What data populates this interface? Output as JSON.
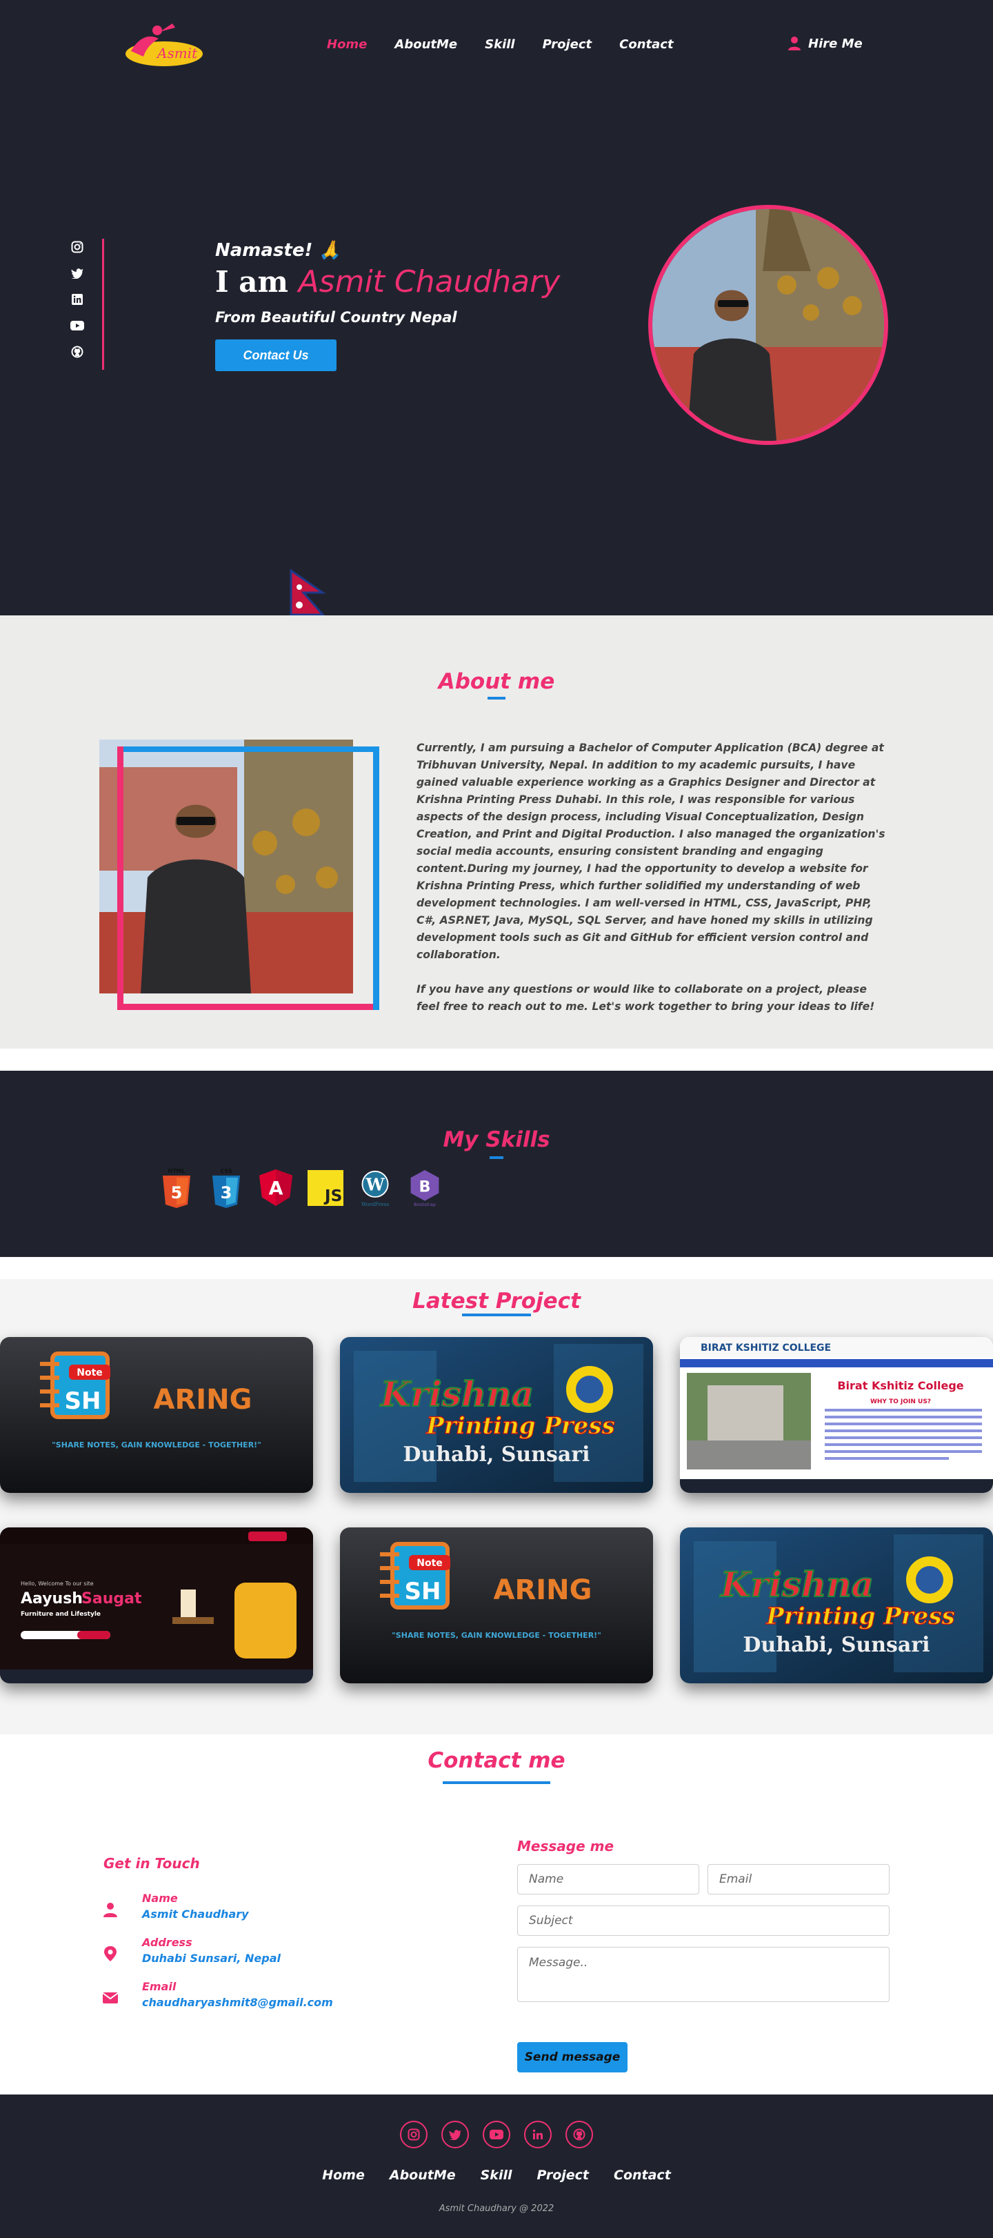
{
  "nav": {
    "logo_text": "Asmit",
    "items": [
      {
        "label": "Home",
        "active": true
      },
      {
        "label": "AboutMe",
        "active": false
      },
      {
        "label": "Skill",
        "active": false
      },
      {
        "label": "Project",
        "active": false
      },
      {
        "label": "Contact",
        "active": false
      }
    ],
    "hire_label": "Hire Me"
  },
  "hero": {
    "greeting": "Namaste! 🙏",
    "iam": "I am",
    "name": "Asmit Chaudhary",
    "tagline": "From Beautiful Country Nepal",
    "cta_label": "Contact Us",
    "social_icons": [
      "instagram-icon",
      "twitter-icon",
      "linkedin-icon",
      "youtube-icon",
      "github-icon"
    ]
  },
  "about": {
    "title": "About me",
    "paragraph1": "Currently, I am pursuing a Bachelor of Computer Application (BCA) degree at Tribhuvan University, Nepal. In addition to my academic pursuits, I have gained valuable experience working as a Graphics Designer and Director at Krishna Printing Press Duhabi. In this role, I was responsible for various aspects of the design process, including Visual Conceptualization, Design Creation, and Print and Digital Production. I also managed the organization's social media accounts, ensuring consistent branding and engaging content.During my journey, I had the opportunity to develop a website for Krishna Printing Press, which further solidified my understanding of web development technologies. I am well-versed in HTML, CSS, JavaScript, PHP, C#, ASP.NET, Java, MySQL, SQL Server, and have honed my skills in utilizing development tools such as Git and GitHub for efficient version control and collaboration.",
    "paragraph2": "If you have any questions or would like to collaborate on a project, please feel free to reach out to me. Let's work together to bring your ideas to life!"
  },
  "skills": {
    "title": "My Skills",
    "items": [
      {
        "name": "HTML",
        "label": "HTML",
        "icon": "html5-icon"
      },
      {
        "name": "CSS",
        "label": "CSS",
        "icon": "css3-icon"
      },
      {
        "name": "Angular",
        "label": "A",
        "icon": "angular-icon"
      },
      {
        "name": "JavaScript",
        "label": "JS",
        "icon": "javascript-icon"
      },
      {
        "name": "WordPress",
        "label": "WordPress",
        "icon": "wordpress-icon"
      },
      {
        "name": "Bootstrap",
        "label": "Bootstrap",
        "icon": "bootstrap-icon"
      }
    ]
  },
  "projects": {
    "title": "Latest Project",
    "items": [
      {
        "kind": "note",
        "brand": "Note",
        "word1": "SH",
        "word2": "ARING",
        "tagline": "\"SHARE NOTES, GAIN KNOWLEDGE - TOGETHER!\""
      },
      {
        "kind": "krishna",
        "line1": "Krishna",
        "line2": "Printing Press",
        "line3": "Duhabi, Sunsari"
      },
      {
        "kind": "college",
        "site_name": "BIRAT  KSHITIZ COLLEGE",
        "heading": "Birat Kshitiz College",
        "sub": "WHY TO JOIN US?"
      },
      {
        "kind": "aayush",
        "welcome": "Hello, Welcome To our site",
        "name1": "Aayush",
        "name2": "Saugat",
        "tag": "Furniture and Lifestyle"
      },
      {
        "kind": "note",
        "brand": "Note",
        "word1": "SH",
        "word2": "ARING",
        "tagline": "\"SHARE NOTES, GAIN KNOWLEDGE - TOGETHER!\""
      },
      {
        "kind": "krishna",
        "line1": "Krishna",
        "line2": "Printing Press",
        "line3": "Duhabi, Sunsari"
      }
    ]
  },
  "contact": {
    "title": "Contact me",
    "get_in_touch": "Get in Touch",
    "name_label": "Name",
    "name_value": "Asmit Chaudhary",
    "address_label": "Address",
    "address_value": "Duhabi Sunsari, Nepal",
    "email_label": "Email",
    "email_value": "chaudharyashmit8@gmail.com",
    "message_heading": "Message me",
    "name_placeholder": "Name",
    "email_placeholder": "Email",
    "subject_placeholder": "Subject",
    "message_placeholder": "Message..",
    "send_label": "Send message"
  },
  "footer": {
    "social_icons": [
      "instagram-icon",
      "twitter-icon",
      "youtube-icon",
      "linkedin-icon",
      "github-icon"
    ],
    "menu": [
      "Home",
      "AboutMe",
      "Skill",
      "Project",
      "Contact"
    ],
    "copyright": "Asmit Chaudhary @ 2022"
  },
  "colors": {
    "accent_pink": "#ef2f72",
    "accent_blue": "#1a94e6",
    "background_dark": "#20232e",
    "about_bg": "#ececeb"
  }
}
